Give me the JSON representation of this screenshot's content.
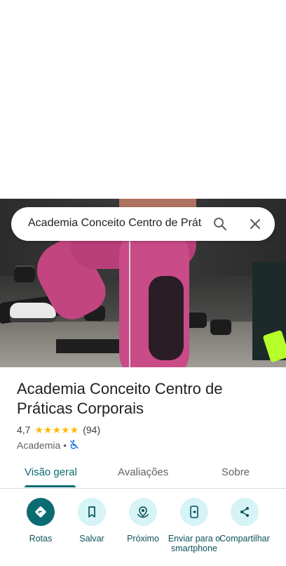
{
  "search": {
    "query": "Academia Conceito Centro de Prátic"
  },
  "place": {
    "name": "Academia Conceito Centro de Práticas Corporais",
    "rating": "4,7",
    "stars": "★★★★★",
    "review_count": "(94)",
    "category": "Academia",
    "separator": "•"
  },
  "tabs": [
    {
      "label": "Visão geral",
      "active": true
    },
    {
      "label": "Avaliações",
      "active": false
    },
    {
      "label": "Sobre",
      "active": false
    }
  ],
  "actions": [
    {
      "label": "Rotas",
      "icon": "directions-icon"
    },
    {
      "label": "Salvar",
      "icon": "bookmark-icon"
    },
    {
      "label": "Próximo",
      "icon": "nearby-icon"
    },
    {
      "label": "Enviar para o smartphone",
      "icon": "send-to-phone-icon"
    },
    {
      "label": "Compartilhar",
      "icon": "share-icon"
    }
  ],
  "colors": {
    "accent": "#0b6b73",
    "chip_bg": "#d6f3f6",
    "star": "#fbbc04"
  }
}
